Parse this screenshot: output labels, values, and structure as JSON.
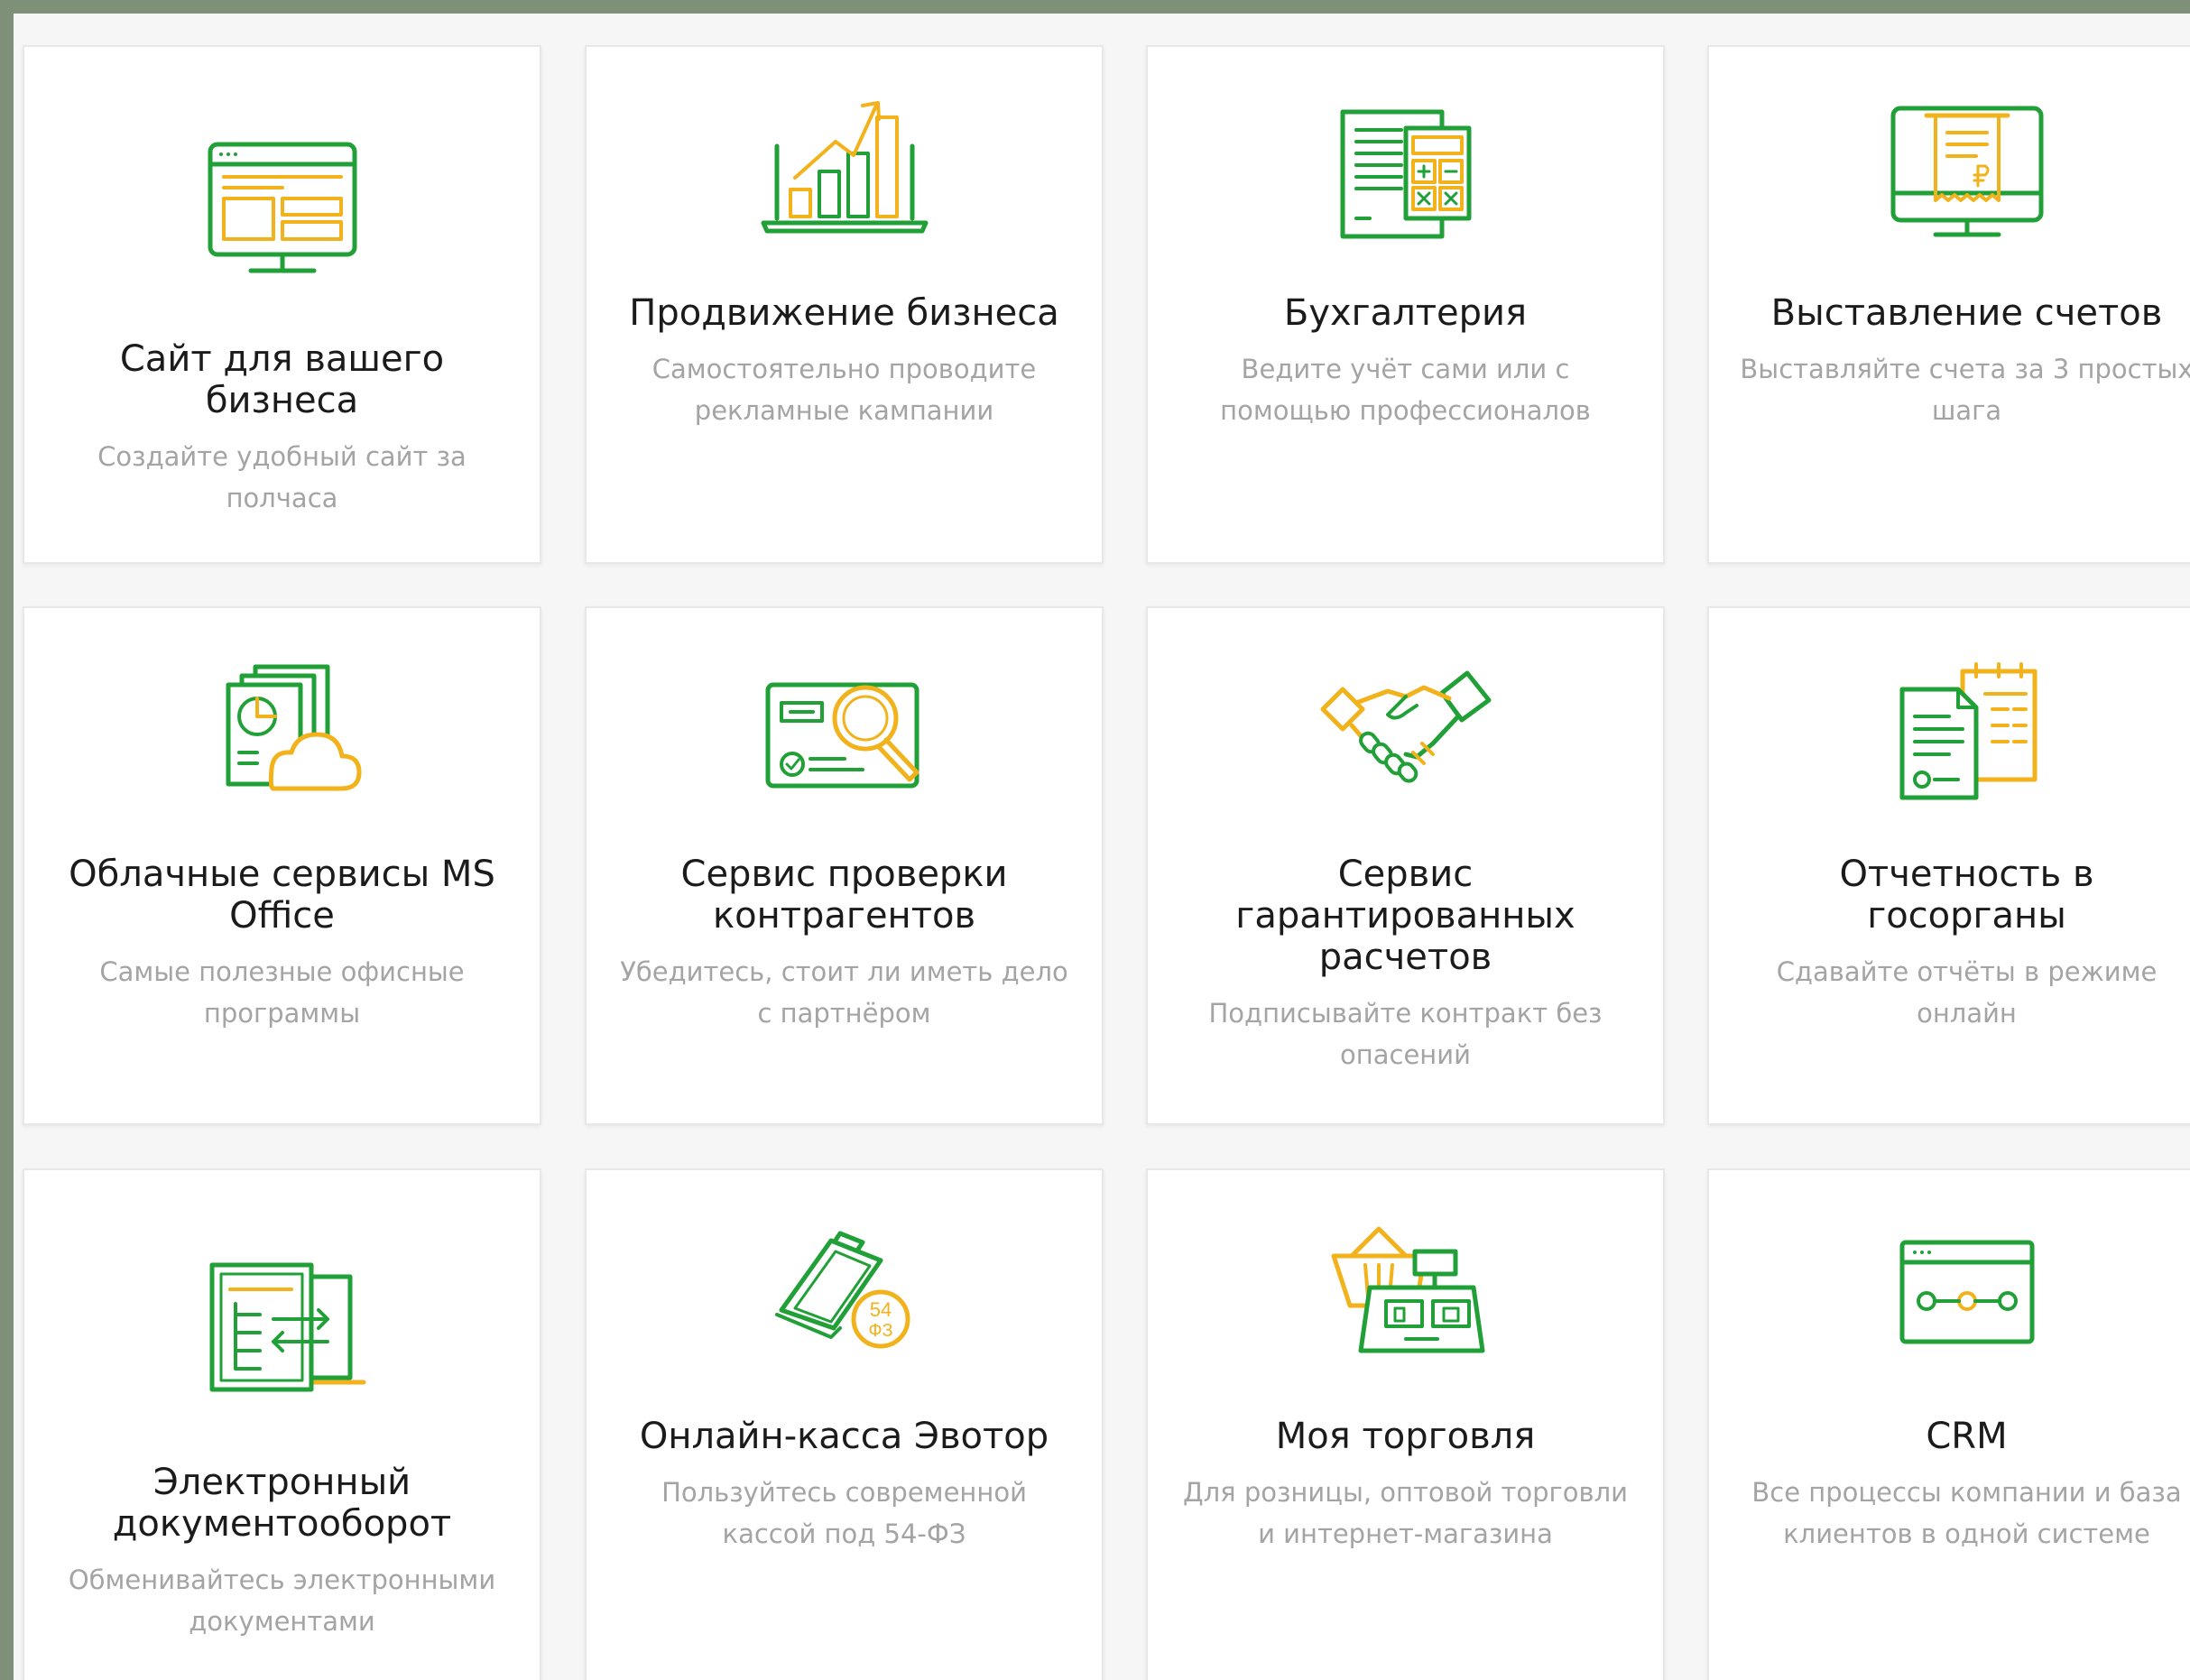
{
  "colors": {
    "green": "#21a038",
    "orange": "#f2b21b"
  },
  "cards": [
    {
      "title": "Сайт для вашего бизнеса",
      "desc": "Создайте удобный сайт за полчаса",
      "icon": "website-icon"
    },
    {
      "title": "Продвижение бизнеса",
      "desc": "Самостоятельно проводите рекламные кампании",
      "icon": "growth-chart-icon"
    },
    {
      "title": "Бухгалтерия",
      "desc": "Ведите учёт сами или с помощью профессионалов",
      "icon": "calculator-icon"
    },
    {
      "title": "Выставление счетов",
      "desc": "Выставляйте счета за 3 простых шага",
      "icon": "invoice-icon"
    },
    {
      "title": "Облачные сервисы MS Office",
      "desc": "Самые полезные офисные программы",
      "icon": "cloud-documents-icon"
    },
    {
      "title": "Сервис проверки контрагентов",
      "desc": "Убедитесь, стоит ли иметь дело с партнёром",
      "icon": "id-check-icon"
    },
    {
      "title": "Сервис гарантированных расчетов",
      "desc": "Подписывайте контракт без опасений",
      "icon": "handshake-icon"
    },
    {
      "title": "Отчетность в госорганы",
      "desc": "Сдавайте отчёты в режиме онлайн",
      "icon": "reports-icon"
    },
    {
      "title": "Электронный документооборот",
      "desc": "Обменивайтесь электронными документами",
      "icon": "document-exchange-icon"
    },
    {
      "title": "Онлайн-касса Эвотор",
      "desc": "Пользуйтесь современной кассой под 54-ФЗ",
      "icon": "cash-register-icon",
      "badge_top": "54",
      "badge_bottom": "ФЗ"
    },
    {
      "title": "Моя торговля",
      "desc": "Для розницы, оптовой торговли и интернет-магазина",
      "icon": "shop-register-icon"
    },
    {
      "title": "CRM",
      "desc": "Все процессы компании и база клиентов в одной системе",
      "icon": "crm-icon"
    }
  ]
}
